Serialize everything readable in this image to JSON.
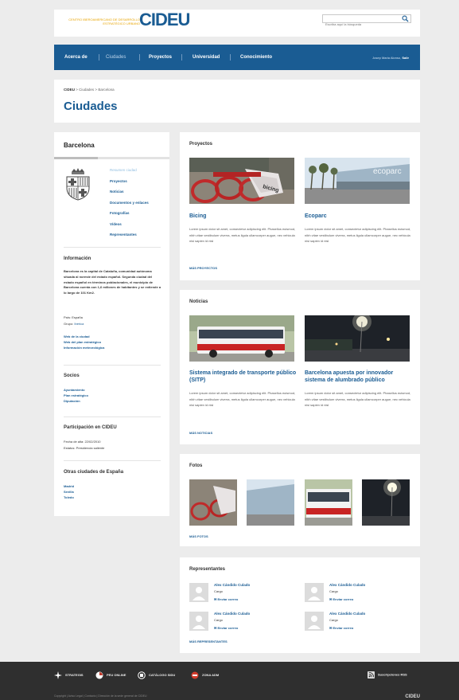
{
  "header": {
    "logo_small_line1": "CENTRO IBEROAMERICANO DE DESARROLLO",
    "logo_small_line2": "ESTRATÉGICO URBANO",
    "logo_big": "CIDEU",
    "search_placeholder": "Escriba aquí la búsqueda",
    "search_icon": "magnifier-icon"
  },
  "nav": {
    "items": [
      "Acerca de",
      "Ciudades",
      "Proyectos",
      "Universidad",
      "Conocimiento"
    ],
    "user": "Josep Maria Alonso,",
    "logout": "Salir"
  },
  "breadcrumb": {
    "root": "CIDEU",
    "sep1": " > ",
    "level1": "Ciudades",
    "sep2": " > ",
    "current": "Barcelona"
  },
  "page_title": "Ciudades",
  "sidebar": {
    "title": "Barcelona",
    "menu": [
      "Resumen ciudad",
      "Proyectos",
      "Noticias",
      "Documentos y enlaces",
      "Fotografías",
      "Vídeos",
      "Representantes"
    ],
    "info_heading": "Información",
    "info_text": "Barcelona es la capital de Cataluña, comunidad autónoma situada al noreste del estado español. Segunda ciudad del estado español en términos poblacionales, el municipio de Barcelona cuenta con 1,6 millones de habitantes y se extiende a lo largo de 101 Km2.",
    "pais_label": "País:",
    "pais_value": "España",
    "grupo_label": "Grupo:",
    "grupo_value": "Ibérica",
    "links": [
      "Web de la ciudad",
      "Web del plan estratégico",
      "Información meteorológica"
    ],
    "socios_heading": "Socios",
    "socios": [
      "Ayuntamiento",
      "Plan estratégico",
      "Diputación"
    ],
    "participacion_heading": "Participación en CIDEU",
    "fecha_alta": "Fecha de alta: 22/02/2010",
    "estatus": "Estatus: Presidencia saliente",
    "otras_heading": "Otras ciudades de España",
    "otras": [
      "Madrid",
      "Sevilla",
      "Toledo"
    ]
  },
  "proyectos": {
    "title": "Proyectos",
    "items": [
      {
        "title": "Bicing",
        "text": "Lorem ipsum dolor sit amet, consectetur adipiscing elit. Phasellus euismod, nibh vitae vestibulum viverra, metus ligula ullamcorper augue, nec vehicula nisi sapien id nisl"
      },
      {
        "title": "Ecoparc",
        "text": "Lorem ipsum dolor sit amet, consectetur adipiscing elit. Phasellus euismod, nibh vitae vestibulum viverra, metus ligula ullamcorper augue, nec vehicula nisi sapien id nisl"
      }
    ],
    "more": "MÁS PROYECTOS",
    "ecoparc_sign": "ecoparc"
  },
  "noticias": {
    "title": "Noticias",
    "items": [
      {
        "title": "Sistema integrado de transporte público (SITP)",
        "text": "Lorem ipsum dolor sit amet, consectetur adipiscing elit. Phasellus euismod, nibh vitae vestibulum viverra, metus ligula ullamcorper augue, nec vehicula nisi sapien id nisl"
      },
      {
        "title": "Barcelona apuesta por innovador sistema de alumbrado público",
        "text": "Lorem ipsum dolor sit amet, consectetur adipiscing elit. Phasellus euismod, nibh vitae vestibulum viverra, metus ligula ullamcorper augue, nec vehicula nisi sapien id nisl"
      }
    ],
    "more": "MÁS NOTICIAS"
  },
  "fotos": {
    "title": "Fotos",
    "more": "MÁS FOTOS"
  },
  "representantes": {
    "title": "Representantes",
    "items": [
      {
        "name": "Alex Cándido Culado",
        "role": "Cargo",
        "mail": "Enviar correo"
      },
      {
        "name": "Alex Cándido Culado",
        "role": "Cargo",
        "mail": "Enviar correo"
      },
      {
        "name": "Alex Cándido Culado",
        "role": "Cargo",
        "mail": "Enviar correo"
      },
      {
        "name": "Alex Cándido Culado",
        "role": "Cargo",
        "mail": "Enviar correo"
      }
    ],
    "more": "MÁS REPRESENTANTES"
  },
  "footer": {
    "items": [
      "STRATEGIS",
      "PEU ONLINE",
      "CATÁLOGO SIDU",
      "ZONA ADM"
    ],
    "rss": "Suscripciones RSS",
    "legal": "Copyright | Aviso Legal | Contacto | Dirección de la sede general de CIDEU",
    "brand": "CIDEU"
  },
  "colors": {
    "brand_blue": "#1a5c93",
    "accent_gold": "#e8a400",
    "footer_bg": "#2f2f2f",
    "page_bg": "#ececec"
  }
}
